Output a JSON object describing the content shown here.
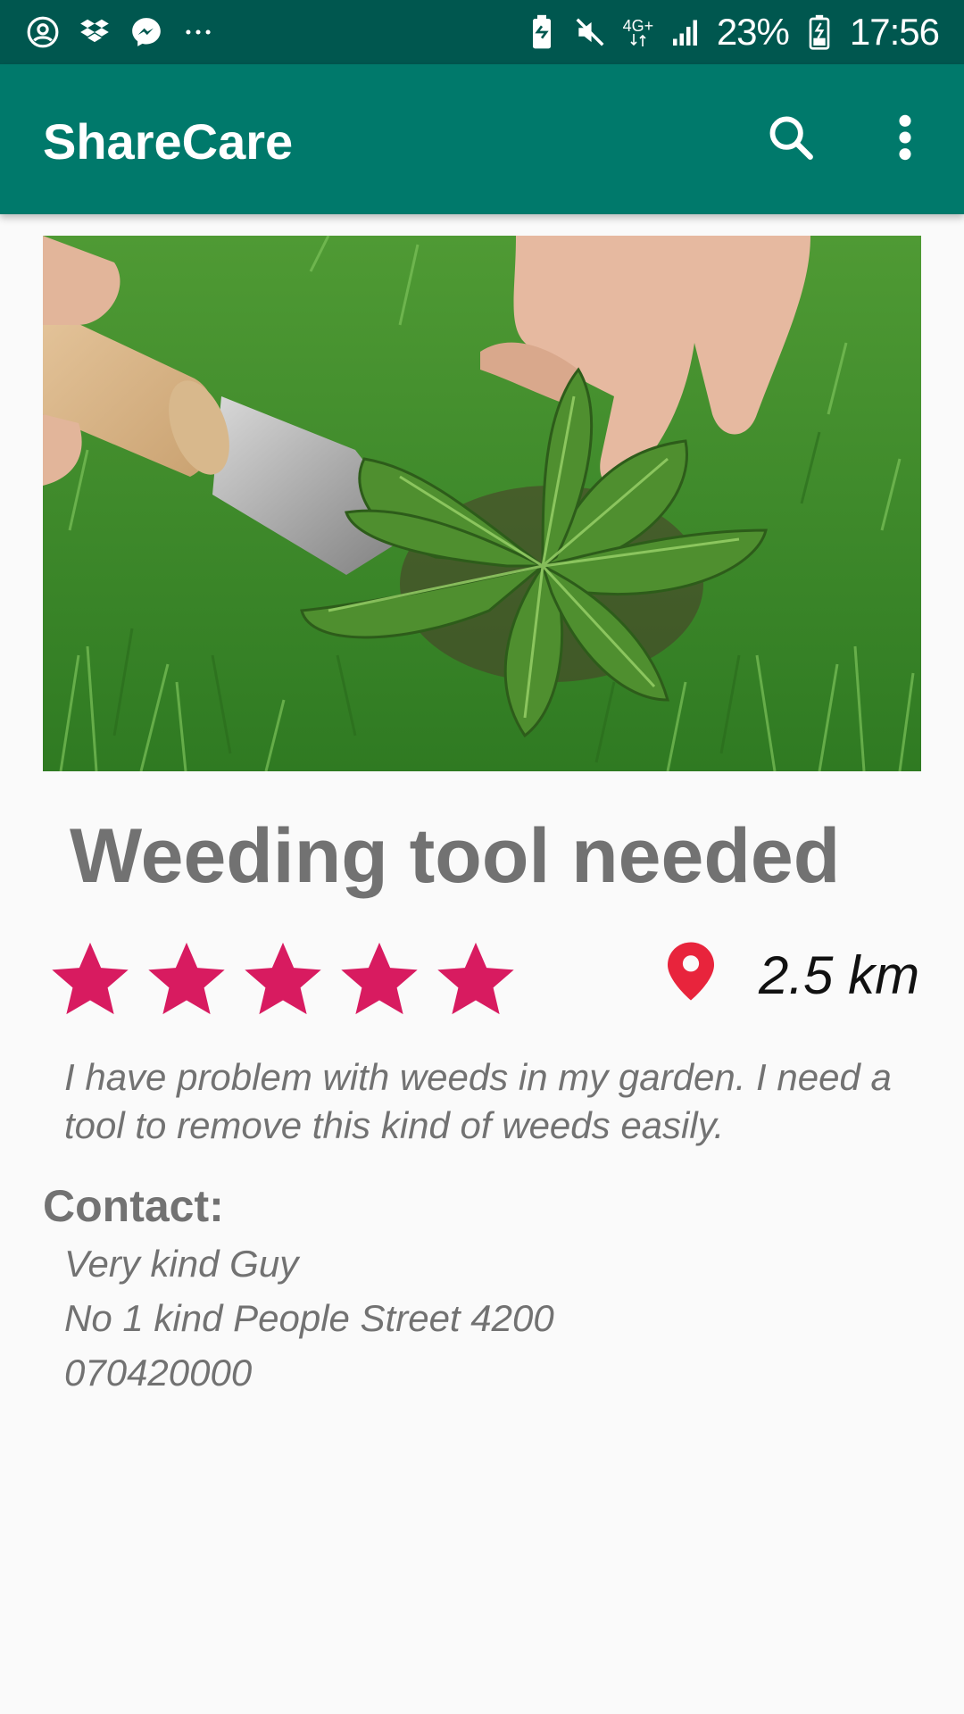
{
  "status_bar": {
    "battery": "23%",
    "time": "17:56",
    "network": "4G+",
    "left_icons": [
      "account-circle-icon",
      "dropbox-icon",
      "messenger-icon",
      "more-dots-icon"
    ],
    "right_icons": [
      "battery-saver-icon",
      "mute-icon",
      "network-icon",
      "signal-icon",
      "battery-icon"
    ]
  },
  "app_bar": {
    "title": "ShareCare",
    "color": "#00796b",
    "actions": [
      "search-icon",
      "more-vert-icon"
    ]
  },
  "post": {
    "image": "weeding-photo",
    "title": "Weeding tool needed",
    "rating": 5,
    "rating_max": 5,
    "star_color": "#d81b60",
    "distance": "2.5 km",
    "pin_color": "#e8243c",
    "description": "I have problem with weeds in my garden. I need a tool to remove this kind of weeds easily.",
    "contact": {
      "label": "Contact:",
      "name": "Very kind Guy",
      "address": "No 1 kind People Street 4200",
      "phone": "070420000"
    }
  }
}
